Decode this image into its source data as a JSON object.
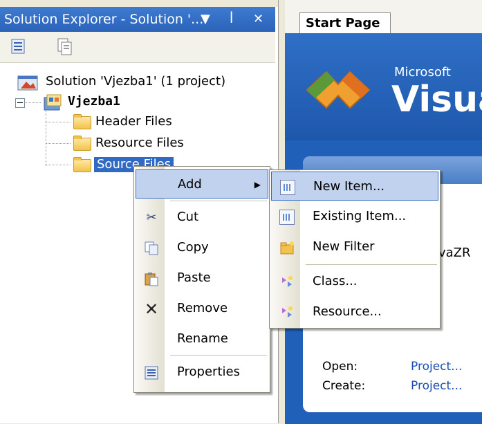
{
  "solution_explorer": {
    "title": "Solution Explorer - Solution '...",
    "title_icons": {
      "dropdown": "▼",
      "pin": "ꟾ",
      "close": "✕"
    },
    "tree": {
      "solution_label": "Solution 'Vjezba1' (1 project)",
      "project_label": "Vjezba1",
      "folders": [
        "Header Files",
        "Resource Files",
        "Source Files"
      ]
    }
  },
  "document": {
    "tab_label": "Start Page",
    "brand_small": "Microsoft",
    "brand_big": "Visua",
    "recent_item": "vaZR",
    "open_label": "Open:",
    "create_label": "Create:",
    "open_link": "Project...",
    "create_link": "Project..."
  },
  "context_menu": {
    "items": {
      "add": "Add",
      "cut": "Cut",
      "copy": "Copy",
      "paste": "Paste",
      "remove": "Remove",
      "rename": "Rename",
      "properties": "Properties"
    },
    "submenu_arrow": "▶"
  },
  "add_submenu": {
    "items": {
      "new_item": "New Item...",
      "existing_item": "Existing Item...",
      "new_filter": "New Filter",
      "class": "Class...",
      "resource": "Resource..."
    }
  },
  "colors": {
    "title_bar": "#2b63b9",
    "selection": "#316ac5",
    "menu_highlight": "#c1d2ee"
  }
}
